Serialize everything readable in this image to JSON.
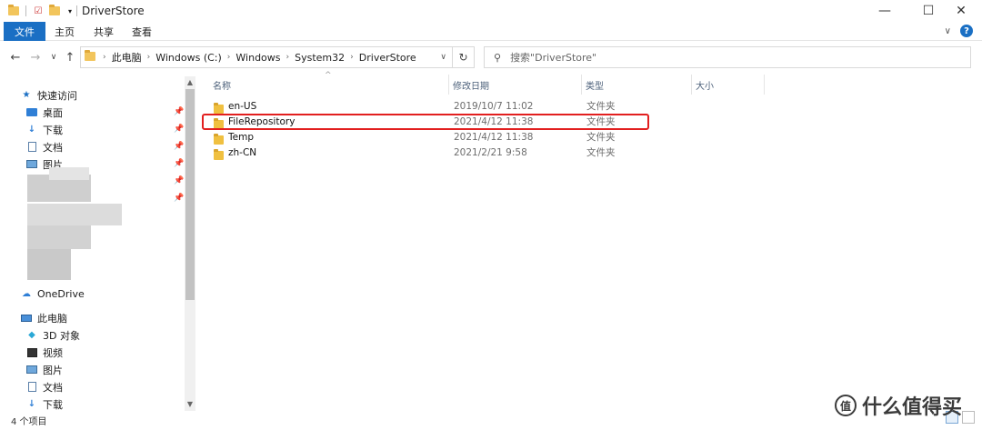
{
  "window": {
    "title": "DriverStore",
    "minimize_glyph": "—",
    "maximize_glyph": "☐",
    "close_glyph": "✕"
  },
  "ribbon": {
    "tabs": [
      {
        "label": "文件",
        "active": true
      },
      {
        "label": "主页",
        "active": false
      },
      {
        "label": "共享",
        "active": false
      },
      {
        "label": "查看",
        "active": false
      }
    ],
    "expand_glyph": "∨",
    "help_glyph": "?"
  },
  "nav": {
    "back_glyph": "←",
    "forward_glyph": "→",
    "recent_glyph": "∨",
    "up_glyph": "↑",
    "refresh_glyph": "↻"
  },
  "address": {
    "crumbs": [
      "此电脑",
      "Windows (C:)",
      "Windows",
      "System32",
      "DriverStore"
    ],
    "dropdown_glyph": "∨"
  },
  "search": {
    "placeholder": "搜索\"DriverStore\""
  },
  "sidebar": {
    "quick_access": "快速访问",
    "quick_items": [
      {
        "label": "桌面",
        "icon": "desktop-icon"
      },
      {
        "label": "下载",
        "icon": "download-icon"
      },
      {
        "label": "文档",
        "icon": "document-icon"
      },
      {
        "label": "图片",
        "icon": "picture-icon"
      }
    ],
    "onedrive": "OneDrive",
    "this_pc": "此电脑",
    "pc_items": [
      {
        "label": "3D 对象",
        "icon": "3d-objects-icon"
      },
      {
        "label": "视频",
        "icon": "video-icon"
      },
      {
        "label": "图片",
        "icon": "picture-icon"
      },
      {
        "label": "文档",
        "icon": "document-icon"
      },
      {
        "label": "下载",
        "icon": "download-icon"
      }
    ]
  },
  "columns": {
    "name": "名称",
    "date": "修改日期",
    "type": "类型",
    "size": "大小"
  },
  "files": [
    {
      "name": "en-US",
      "date": "2019/10/7 11:02",
      "type": "文件夹"
    },
    {
      "name": "FileRepository",
      "date": "2021/4/12 11:38",
      "type": "文件夹"
    },
    {
      "name": "Temp",
      "date": "2021/4/12 11:38",
      "type": "文件夹"
    },
    {
      "name": "zh-CN",
      "date": "2021/2/21 9:58",
      "type": "文件夹"
    }
  ],
  "status": {
    "item_count": "4 个项目"
  },
  "watermark": {
    "text": "什么值得买",
    "logo_glyph": "值"
  },
  "colors": {
    "accent": "#1a6fc4",
    "highlight": "#e21f1f",
    "folder": "#f0c040"
  }
}
